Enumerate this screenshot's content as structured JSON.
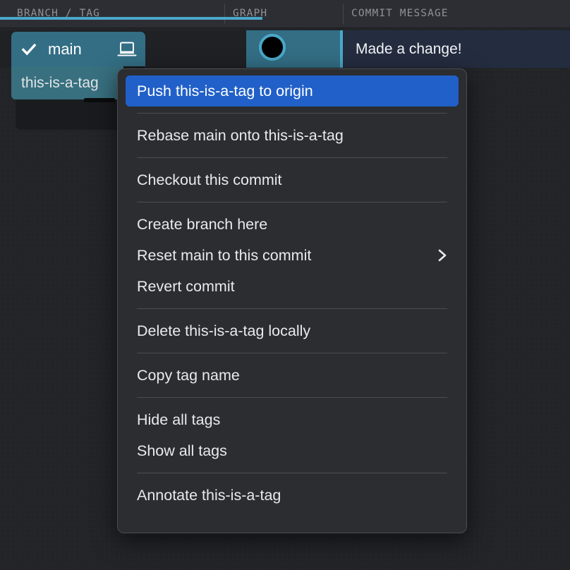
{
  "header": {
    "columns": [
      {
        "key": "branch_tag",
        "label": "BRANCH / TAG"
      },
      {
        "key": "graph",
        "label": "GRAPH"
      },
      {
        "key": "commit_message",
        "label": "COMMIT MESSAGE"
      }
    ]
  },
  "commit_row": {
    "message": "Made a change!",
    "selected": true,
    "node_color": "#4aa8c9",
    "node_fill": "#000000",
    "highlight_color": "#336e85",
    "selected_row_color": "#242c3f"
  },
  "refs": {
    "branch": {
      "name": "main",
      "checked_out": true,
      "check_icon": "check-icon",
      "host_icon": "laptop-icon",
      "color": "#336e85"
    },
    "tag": {
      "name": "this-is-a-tag",
      "color": "#38707f"
    }
  },
  "context_menu": {
    "highlight_color": "#2160c8",
    "background_color": "#2b2d31",
    "items": [
      {
        "id": "push-tag-to-origin",
        "label": "Push this-is-a-tag to origin",
        "highlighted": true,
        "submenu": false
      },
      {
        "id": "separator-1",
        "type": "separator"
      },
      {
        "id": "rebase-main-onto-tag",
        "label": "Rebase main onto this-is-a-tag",
        "highlighted": false,
        "submenu": false
      },
      {
        "id": "separator-2",
        "type": "separator"
      },
      {
        "id": "checkout-this-commit",
        "label": "Checkout this commit",
        "highlighted": false,
        "submenu": false
      },
      {
        "id": "separator-3",
        "type": "separator"
      },
      {
        "id": "create-branch-here",
        "label": "Create branch here",
        "highlighted": false,
        "submenu": false
      },
      {
        "id": "reset-main-to-this-commit",
        "label": "Reset main to this commit",
        "highlighted": false,
        "submenu": true,
        "submenu_icon": "chevron-right-icon"
      },
      {
        "id": "revert-commit",
        "label": "Revert commit",
        "highlighted": false,
        "submenu": false
      },
      {
        "id": "separator-4",
        "type": "separator"
      },
      {
        "id": "delete-tag-locally",
        "label": "Delete this-is-a-tag locally",
        "highlighted": false,
        "submenu": false
      },
      {
        "id": "separator-5",
        "type": "separator"
      },
      {
        "id": "copy-tag-name",
        "label": "Copy tag name",
        "highlighted": false,
        "submenu": false
      },
      {
        "id": "separator-6",
        "type": "separator"
      },
      {
        "id": "hide-all-tags",
        "label": "Hide all tags",
        "highlighted": false,
        "submenu": false
      },
      {
        "id": "show-all-tags",
        "label": "Show all tags",
        "highlighted": false,
        "submenu": false
      },
      {
        "id": "separator-7",
        "type": "separator"
      },
      {
        "id": "annotate-tag",
        "label": "Annotate this-is-a-tag",
        "highlighted": false,
        "submenu": false
      }
    ]
  }
}
